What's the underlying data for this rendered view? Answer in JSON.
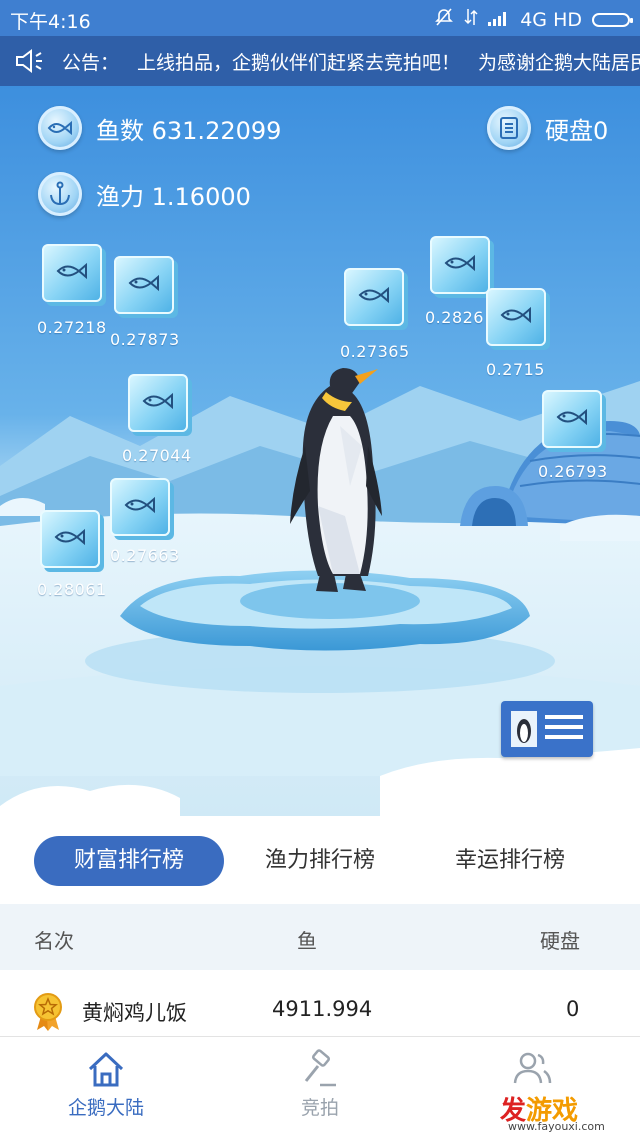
{
  "status_bar": {
    "time": "下午4:16",
    "network": "4G HD"
  },
  "notice": {
    "label": "公告：",
    "text": "上线拍品，企鹅伙伴们赶紧去竞拍吧！",
    "text2": "为感谢企鹅大陆居民们的"
  },
  "stats": {
    "fish": "鱼数 631.22099",
    "power": "渔力 1.16000",
    "disk": "硬盘0"
  },
  "fish_drops": [
    {
      "value": "0.27218"
    },
    {
      "value": "0.27873"
    },
    {
      "value": "0.27365"
    },
    {
      "value": "0.2826"
    },
    {
      "value": "0.2715"
    },
    {
      "value": "0.27044"
    },
    {
      "value": "0.26793"
    },
    {
      "value": "0.27663"
    },
    {
      "value": "0.28061"
    }
  ],
  "tabs": [
    {
      "label": "财富排行榜",
      "active": true
    },
    {
      "label": "渔力排行榜",
      "active": false
    },
    {
      "label": "幸运排行榜",
      "active": false
    }
  ],
  "table": {
    "headers": {
      "rank": "名次",
      "fish": "鱼",
      "disk": "硬盘"
    },
    "rows": [
      {
        "name": "黄焖鸡儿饭",
        "fish": "4911.994",
        "disk": "0"
      }
    ]
  },
  "bottom_nav": [
    {
      "label": "企鹅大陆",
      "active": true,
      "icon": "home-icon"
    },
    {
      "label": "竞拍",
      "active": false,
      "icon": "gavel-icon"
    },
    {
      "label": "",
      "active": false,
      "icon": "friends-icon"
    }
  ],
  "watermark": {
    "logo_a": "发",
    "logo_b": "游戏",
    "url": "www.fayouxi.com"
  },
  "colors": {
    "accent": "#3a6cc0",
    "status_bar": "#3f7fd0",
    "notice_bar": "#2f5fa8",
    "sky": "#3a90db"
  }
}
